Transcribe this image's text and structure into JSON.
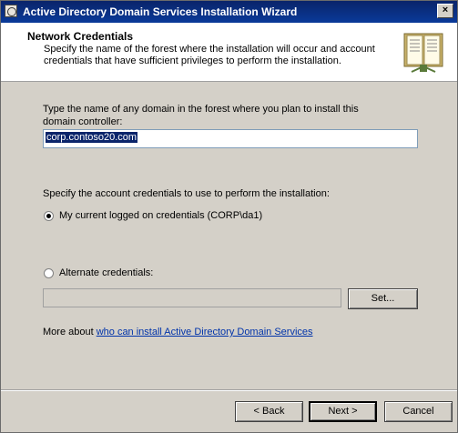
{
  "window": {
    "title": "Active Directory Domain Services Installation Wizard",
    "close_glyph": "×"
  },
  "header": {
    "title": "Network Credentials",
    "description": "Specify the name of the forest where the installation will occur and account credentials that have sufficient privileges to perform the installation.",
    "icon": "book-icon"
  },
  "domain": {
    "label": "Type the name of any domain in the forest where you plan to install this domain controller:",
    "value": "corp.contoso20.com"
  },
  "credentials": {
    "label": "Specify the account credentials to use to perform the installation:",
    "option_current": "My current logged on credentials (CORP\\da1)",
    "option_alternate": "Alternate credentials:",
    "alternate_value": "",
    "set_button": "Set..."
  },
  "more": {
    "prefix": "More about ",
    "link": "who can install Active Directory Domain Services"
  },
  "buttons": {
    "back": "< Back",
    "next": "Next >",
    "cancel": "Cancel"
  }
}
